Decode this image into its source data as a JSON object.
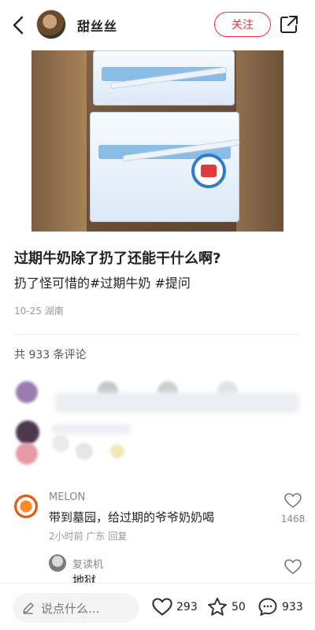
{
  "header": {
    "username": "甜丝丝",
    "follow_label": "关注"
  },
  "post": {
    "title": "过期牛奶除了扔了还能干什么啊?",
    "body": "扔了怪可惜的#过期牛奶 #提问",
    "date": "10-25",
    "location": "湖南"
  },
  "comments_summary": {
    "count_text": "共 933 条评论"
  },
  "comments": [
    {
      "name": "MELON",
      "text": "带到墓园，给过期的爷爷奶奶喝",
      "time": "2小时前",
      "location": "广东",
      "reply_label": "回复",
      "likes": "1468"
    },
    {
      "name": "复读机",
      "text": "地狱",
      "likes": ""
    }
  ],
  "bottom_bar": {
    "input_placeholder": "说点什么...",
    "likes": "293",
    "stars": "50",
    "comments": "933"
  },
  "colors": {
    "accent": "#ff2442"
  }
}
